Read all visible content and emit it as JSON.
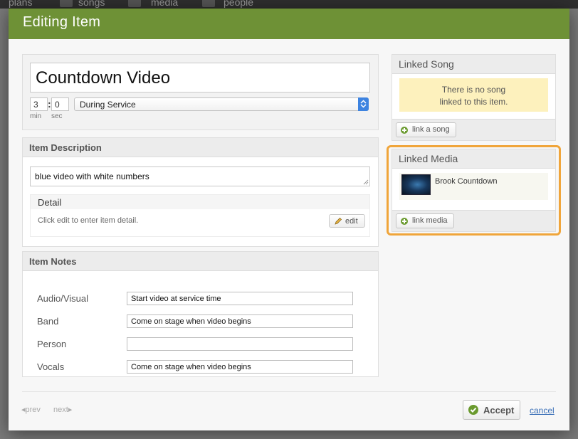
{
  "background_nav": {
    "items": [
      "plans",
      "songs",
      "media",
      "people"
    ]
  },
  "modal": {
    "title": "Editing Item"
  },
  "item": {
    "title": "Countdown Video",
    "length_min": "3",
    "length_sec": "0",
    "min_label": "min",
    "sec_label": "sec",
    "position": "During Service"
  },
  "description": {
    "section_title": "Item Description",
    "value": "blue video with white numbers",
    "detail_title": "Detail",
    "detail_text": "Click edit to enter item detail.",
    "edit_label": "edit"
  },
  "notes": {
    "section_title": "Item Notes",
    "rows": [
      {
        "label": "Audio/Visual",
        "value": "Start video at service time"
      },
      {
        "label": "Band",
        "value": "Come on stage when video begins"
      },
      {
        "label": "Person",
        "value": ""
      },
      {
        "label": "Vocals",
        "value": "Come on stage when video begins"
      }
    ]
  },
  "linked_song": {
    "section_title": "Linked Song",
    "empty_line1": "There is no song",
    "empty_line2": "linked to this item.",
    "button_label": "link a song"
  },
  "linked_media": {
    "section_title": "Linked Media",
    "item_name": "Brook Countdown",
    "button_label": "link media",
    "highlight_color": "#f0a53a"
  },
  "footer": {
    "prev_label": "◂prev",
    "next_label": "next▸",
    "accept_label": "Accept",
    "cancel_label": "cancel"
  },
  "colors": {
    "header": "#6e9136",
    "accent_green": "#6a9a2e",
    "link": "#3a6fb7"
  }
}
